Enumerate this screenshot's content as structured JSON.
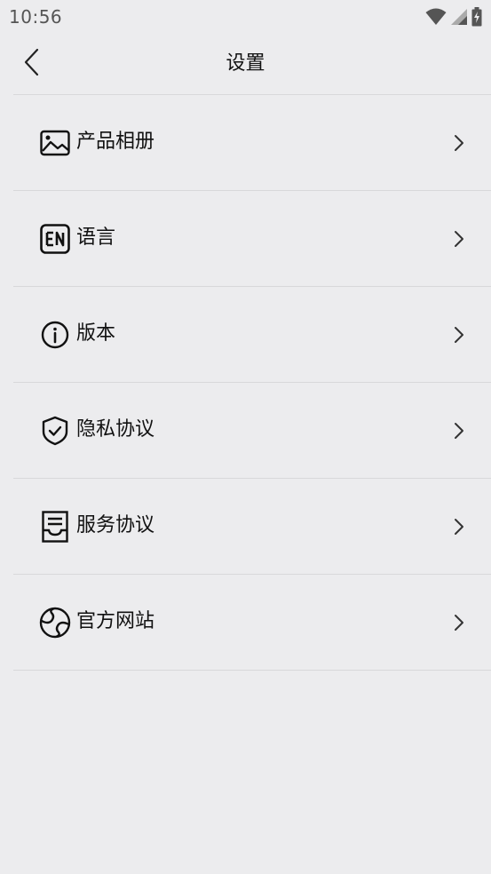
{
  "status_bar": {
    "time": "10:56",
    "icons": [
      "wifi-icon",
      "cellular-signal-icon",
      "battery-charging-icon"
    ]
  },
  "header": {
    "title": "设置",
    "back_icon": "back-arrow-icon"
  },
  "settings": {
    "items": [
      {
        "label": "产品相册",
        "icon": "photo-album-icon"
      },
      {
        "label": "语言",
        "icon": "language-en-icon"
      },
      {
        "label": "版本",
        "icon": "info-icon"
      },
      {
        "label": "隐私协议",
        "icon": "shield-check-icon"
      },
      {
        "label": "服务协议",
        "icon": "service-document-icon"
      },
      {
        "label": "官方网站",
        "icon": "globe-icon"
      }
    ]
  },
  "colors": {
    "background": "#ececee",
    "text": "#111111",
    "divider": "#d8d8da",
    "status_text": "#555555"
  }
}
